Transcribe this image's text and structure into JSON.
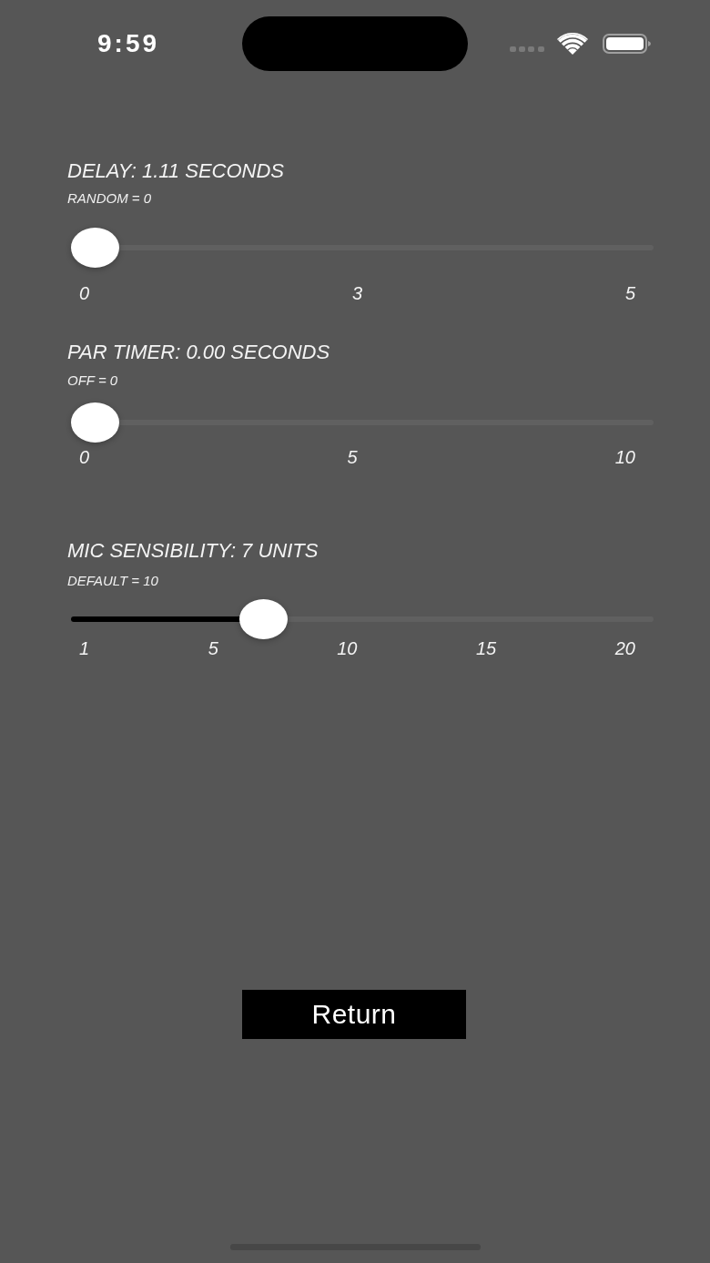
{
  "status_bar": {
    "time": "9:59"
  },
  "sliders": [
    {
      "title": "DELAY: 1.11 SECONDS",
      "note": "RANDOM = 0",
      "level": 0,
      "ticks": [
        "0",
        "3",
        "5"
      ]
    },
    {
      "title": "PAR TIMER: 0.00 SECONDS",
      "note": "OFF = 0",
      "level": 0,
      "ticks": [
        "0",
        "5",
        "10"
      ]
    },
    {
      "title": "MIC SENSIBILITY: 7 UNITS",
      "note": "DEFAULT = 10",
      "level": 0.316,
      "ticks": [
        "1",
        "5",
        "10",
        "15",
        "20"
      ]
    }
  ],
  "return_button": {
    "label": "Return"
  }
}
